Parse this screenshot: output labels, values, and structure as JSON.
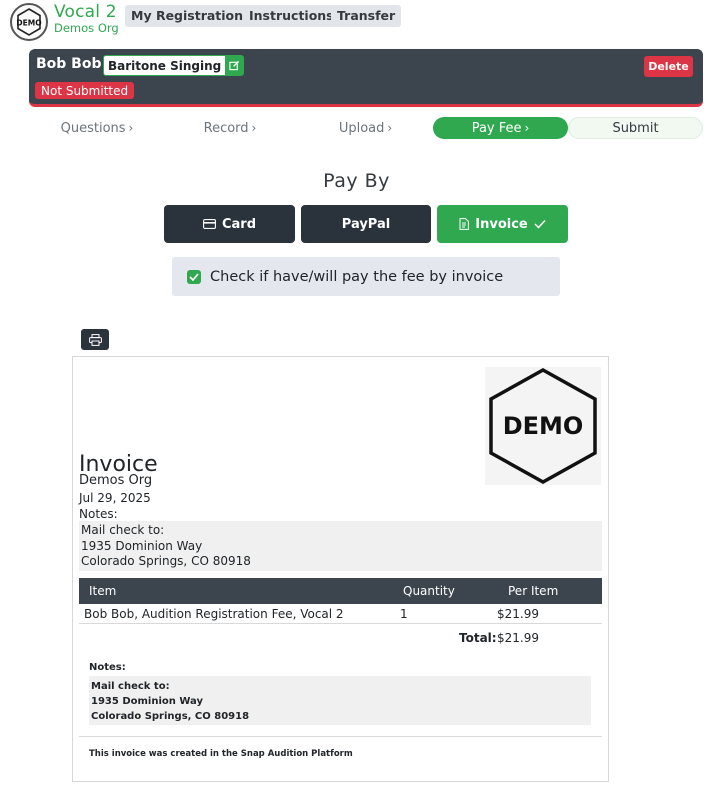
{
  "app": {
    "logo_text": "DEMO",
    "title": "Vocal 2",
    "subtitle": "Demos Org",
    "brand_color": "#2fa84f"
  },
  "nav": {
    "items": [
      "My Registrations",
      "Instructions",
      "Transfer"
    ]
  },
  "registration": {
    "name": "Bob Bob",
    "category": "Baritone Singing",
    "status": "Not Submitted",
    "delete_label": "Delete",
    "status_color": "#dc3545"
  },
  "steps": [
    {
      "label": "Questions",
      "chevron": "›"
    },
    {
      "label": "Record",
      "chevron": "›"
    },
    {
      "label": "Upload",
      "chevron": "›"
    },
    {
      "label": "Pay Fee",
      "chevron": "›",
      "active": true
    },
    {
      "label": "Submit"
    }
  ],
  "pay": {
    "title": "Pay By",
    "options": [
      {
        "label": "Card",
        "icon": "credit-card-icon"
      },
      {
        "label": "PayPal"
      },
      {
        "label": "Invoice",
        "icon": "invoice-icon",
        "selected": true
      }
    ],
    "invoice_checkbox": {
      "checked": true,
      "label": "Check if have/will pay the fee by invoice"
    }
  },
  "invoice": {
    "logo_text": "DEMO",
    "title": "Invoice",
    "org": "Demos Org",
    "date": "Jul 29, 2025",
    "notes_label": "Notes:",
    "notes": [
      "Mail check to:",
      "1935 Dominion Way",
      "Colorado Springs, CO 80918"
    ],
    "columns": {
      "item": "Item",
      "quantity": "Quantity",
      "per_item": "Per Item"
    },
    "rows": [
      {
        "item": "Bob Bob, Audition Registration Fee, Vocal 2",
        "quantity": "1",
        "per_item": "$21.99"
      }
    ],
    "total_label": "Total:",
    "total_value": "$21.99",
    "footer_notes_label": "Notes:",
    "footer_notes": [
      "Mail check to:",
      "1935 Dominion Way",
      "Colorado Springs, CO 80918"
    ],
    "footer": "This invoice was created in the Snap Audition Platform"
  }
}
